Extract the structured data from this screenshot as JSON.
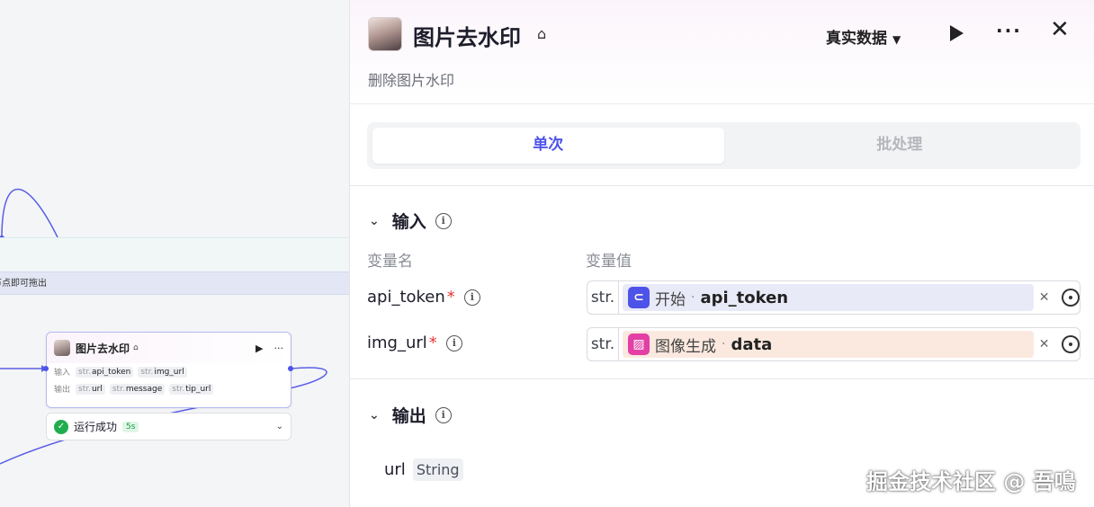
{
  "canvas": {
    "hint": "拖拽节点即可拖出",
    "node": {
      "title": "图片去水印",
      "input_label": "输入",
      "output_label": "输出",
      "inputs": [
        {
          "type": "str.",
          "name": "api_token"
        },
        {
          "type": "str.",
          "name": "img_url"
        }
      ],
      "outputs": [
        {
          "type": "str.",
          "name": "url"
        },
        {
          "type": "str.",
          "name": "message"
        },
        {
          "type": "str.",
          "name": "tip_url"
        }
      ],
      "status_text": "运行成功",
      "duration": "5s"
    }
  },
  "panel": {
    "title": "图片去水印",
    "description": "删除图片水印",
    "data_mode": "真实数据",
    "tabs": [
      {
        "label": "单次",
        "active": true
      },
      {
        "label": "批处理",
        "active": false
      }
    ],
    "input_section": {
      "title": "输入",
      "col_name": "变量名",
      "col_value": "变量值",
      "variables": [
        {
          "name": "api_token",
          "required": "*",
          "type": "str.",
          "source": "开始",
          "source_icon": "start-node-icon",
          "value": "api_token",
          "chip_color": "#e9eaf8",
          "icon_color": "#4d53e8"
        },
        {
          "name": "img_url",
          "required": "*",
          "type": "str.",
          "source": "图像生成",
          "source_icon": "image-gen-icon",
          "value": "data",
          "chip_color": "#fbe9df",
          "icon_color": "#e33fa5"
        }
      ]
    },
    "output_section": {
      "title": "输出",
      "outputs": [
        {
          "name": "url",
          "type": "String"
        }
      ]
    }
  },
  "watermark": "掘金技术社区 @ 吾鳴",
  "colors": {
    "accent": "#4d53e8",
    "success": "#1fad4e",
    "required": "#e53935"
  }
}
